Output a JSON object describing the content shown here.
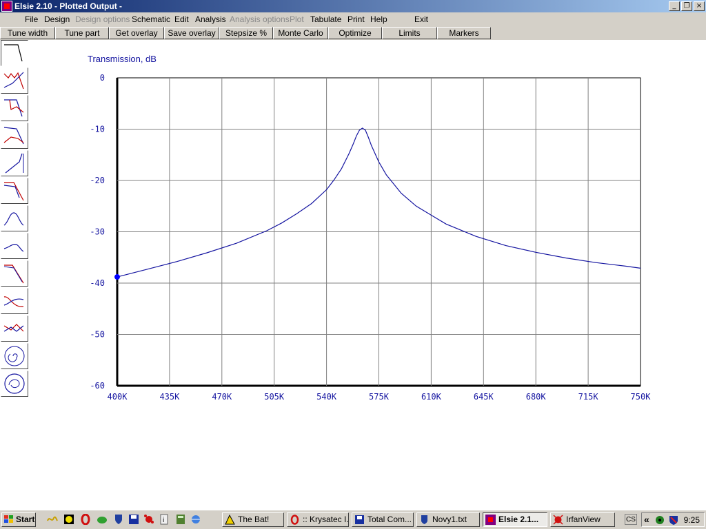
{
  "window": {
    "title": "Elsie 2.10 - Plotted Output -"
  },
  "menu": [
    {
      "label": "File",
      "enabled": true
    },
    {
      "label": "Design",
      "enabled": true
    },
    {
      "label": "Design options",
      "enabled": false
    },
    {
      "label": "Schematic",
      "enabled": true
    },
    {
      "label": "Edit",
      "enabled": true
    },
    {
      "label": "Analysis",
      "enabled": true
    },
    {
      "label": "Analysis options",
      "enabled": false
    },
    {
      "label": "Plot",
      "enabled": false
    },
    {
      "label": "Tabulate",
      "enabled": true
    },
    {
      "label": "Print",
      "enabled": true
    },
    {
      "label": "Help",
      "enabled": true
    },
    {
      "label": "Exit",
      "enabled": true
    }
  ],
  "toolbar": [
    "Tune width",
    "Tune part",
    "Get overlay",
    "Save overlay",
    "Stepsize %",
    "Monte Carlo",
    "Optimize",
    "Limits",
    "Markers"
  ],
  "palette": [
    "lowpass-response",
    "bandpass-ripple",
    "lowpass-delay",
    "lowpass-return-loss",
    "highpass-response",
    "lowpass-steep",
    "bandpass-hump",
    "lowpass-rolloff",
    "bandpass-curves",
    "bandstop-curves",
    "smith-chart-spiral",
    "smith-chart"
  ],
  "chart_data": {
    "type": "line",
    "ylabel": "Transmission, dB",
    "xlim": [
      400,
      750
    ],
    "ylim": [
      -60,
      0
    ],
    "grid": true,
    "xticks": [
      "400K",
      "435K",
      "470K",
      "505K",
      "540K",
      "575K",
      "610K",
      "645K",
      "680K",
      "715K",
      "750K"
    ],
    "yticks": [
      "0",
      "-10",
      "-20",
      "-30",
      "-40",
      "-50",
      "-60"
    ],
    "series": [
      {
        "color": "#1414a0",
        "x": [
          400,
          420,
          440,
          460,
          480,
          500,
          510,
          520,
          530,
          540,
          545,
          550,
          555,
          558,
          560,
          562,
          564,
          566,
          568,
          570,
          575,
          580,
          590,
          600,
          620,
          640,
          660,
          680,
          700,
          720,
          740,
          750
        ],
        "y": [
          -38.8,
          -37.3,
          -35.8,
          -34.1,
          -32.2,
          -29.8,
          -28.3,
          -26.5,
          -24.5,
          -21.8,
          -19.9,
          -17.7,
          -14.8,
          -12.8,
          -11.3,
          -10.2,
          -9.8,
          -10.2,
          -11.6,
          -13.2,
          -16.4,
          -18.9,
          -22.5,
          -25.0,
          -28.5,
          -30.9,
          -32.7,
          -34.0,
          -35.1,
          -36.0,
          -36.7,
          -37.1
        ]
      }
    ],
    "marker": {
      "x": 400,
      "y": -38.8,
      "color": "#0000ff"
    }
  },
  "taskbar": {
    "start_label": "Start",
    "quicklaunch": [
      "winamp-icon",
      "smiley-icon",
      "opera-icon",
      "frog-icon",
      "shield-icon",
      "floppy-icon",
      "splat-icon",
      "info-icon",
      "calc-icon",
      "browser-icon"
    ],
    "tasks": [
      {
        "label": "The Bat!",
        "icon": "bat-icon",
        "active": false
      },
      {
        "label": ":: Krysatec I...",
        "icon": "opera-icon",
        "active": false
      },
      {
        "label": "Total Com...",
        "icon": "floppy-icon",
        "active": false
      },
      {
        "label": "Novy1.txt",
        "icon": "notepad-icon",
        "active": false
      },
      {
        "label": "Elsie 2.1...",
        "icon": "elsie-icon",
        "active": true
      },
      {
        "label": "IrfanView",
        "icon": "irfanview-icon",
        "active": false
      }
    ],
    "language": "CS",
    "tray_expand": "«",
    "clock": "9:25"
  }
}
